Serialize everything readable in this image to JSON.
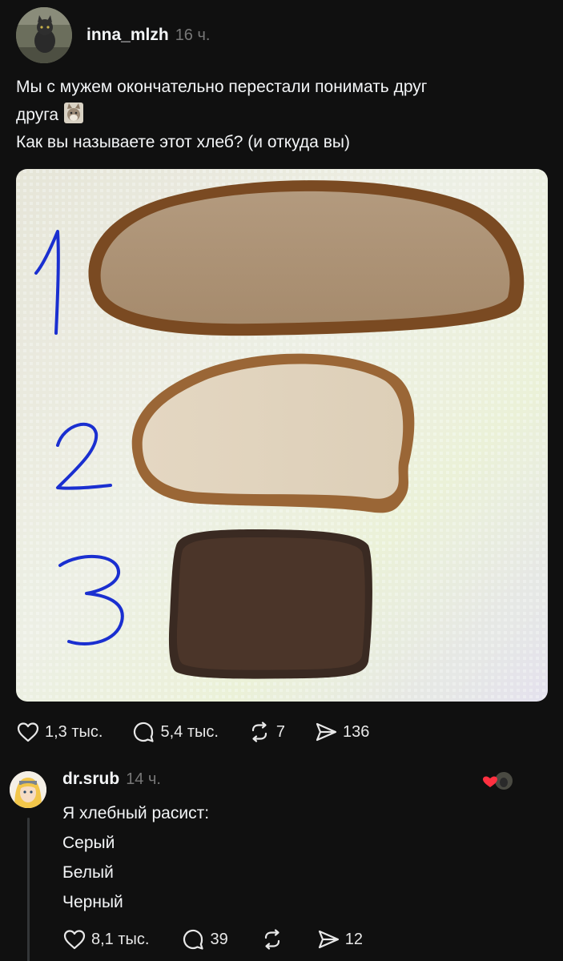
{
  "post": {
    "username": "inna_mlzh",
    "timestamp": "16 ч.",
    "text_line1": "Мы с мужем окончательно перестали понимать друг",
    "text_line2": "друга",
    "text_line3": "Как вы называете этот хлеб? (и откуда вы)",
    "image_labels": [
      "1",
      "2",
      "3"
    ],
    "stats": {
      "likes": "1,3 тыс.",
      "comments": "5,4 тыс.",
      "reposts": "7",
      "shares": "136"
    }
  },
  "reply": {
    "username": "dr.srub",
    "timestamp": "14 ч.",
    "lines": [
      "Я хлебный расист:",
      "Серый",
      "Белый",
      "Черный"
    ],
    "stats": {
      "likes": "8,1 тыс.",
      "comments": "39",
      "shares": "12"
    }
  },
  "colors": {
    "background": "#101010",
    "text": "#f3f5f7",
    "muted": "#777777",
    "heart": "#ff3040",
    "pen_blue": "#1a2fd0"
  },
  "icons": [
    "heart-icon",
    "comment-icon",
    "repost-icon",
    "share-icon",
    "cat-emoji-icon"
  ]
}
